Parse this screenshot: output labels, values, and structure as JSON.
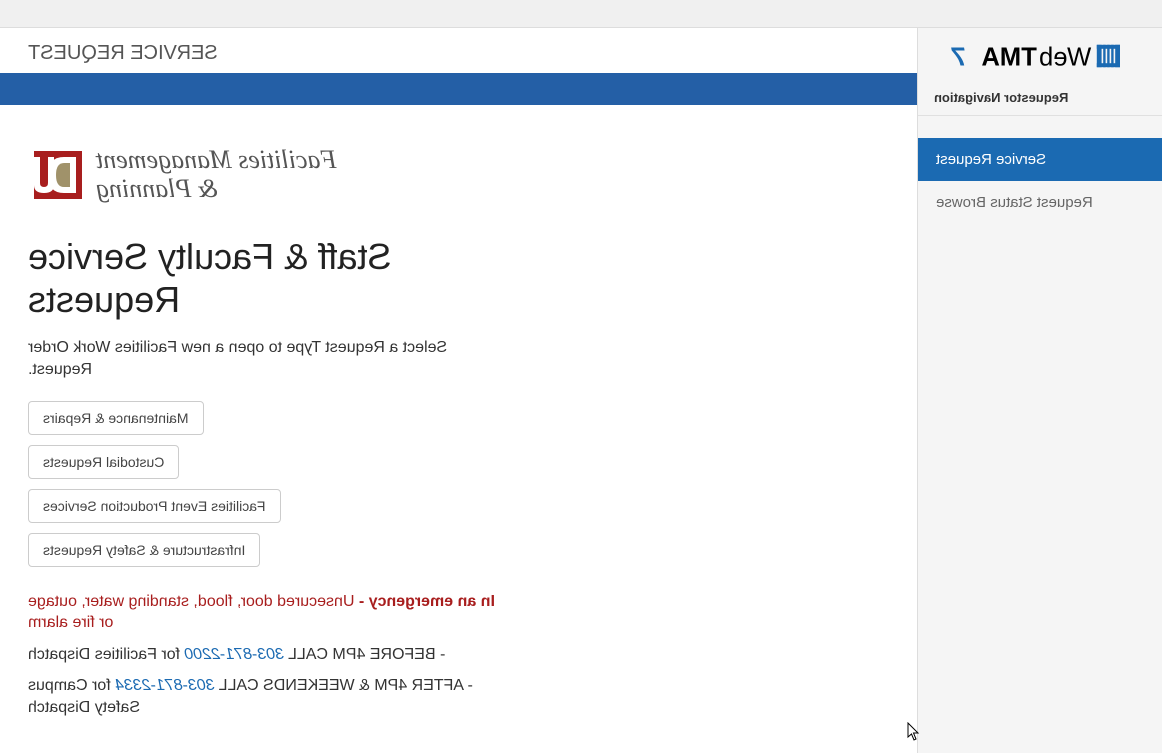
{
  "app": {
    "logo_prefix": "Web",
    "logo_suffix": "TMA",
    "logo_version": "7"
  },
  "sidebar": {
    "header": "Requestor Navigation",
    "items": [
      {
        "label": "Service Request",
        "active": true
      },
      {
        "label": "Request Status Browse",
        "active": false
      }
    ]
  },
  "page": {
    "title": "SERVICE REQUEST"
  },
  "dept": {
    "line1": "Facilities Management",
    "line2": "& Planning"
  },
  "content": {
    "heading": "Staff & Faculty Service Requests",
    "intro": "Select a Request Type to open a new Facilities Work Order Request.",
    "buttons": [
      "Maintenance & Repairs",
      "Custodial Requests",
      "Facilities Event Production Services",
      "Infrastructure & Safety Requests"
    ],
    "emergency_label": "In an emergency - ",
    "emergency_detail": "Unsecured door, flood, standing water, outage or fire alarm",
    "contact1_prefix": "- BEFORE 4PM CALL ",
    "contact1_phone": "303-871-2200",
    "contact1_suffix": " for Facilities Dispatch",
    "contact2_prefix": "- AFTER 4PM & WEEKENDS CALL ",
    "contact2_phone": "303-871-2334",
    "contact2_suffix": " for Campus Safety Dispatch"
  }
}
